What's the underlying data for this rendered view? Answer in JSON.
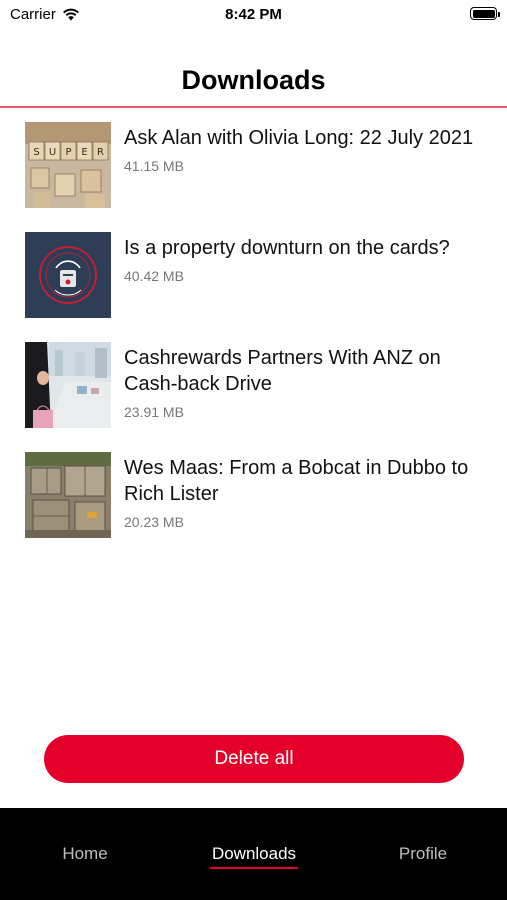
{
  "status_bar": {
    "carrier": "Carrier",
    "time": "8:42 PM"
  },
  "header": {
    "title": "Downloads"
  },
  "downloads": [
    {
      "title": "Ask Alan with Olivia Long: 22 July 2021",
      "size": "41.15 MB",
      "thumbnail": "super-wooden-blocks-image"
    },
    {
      "title": "Is a property downturn on the cards?",
      "size": "40.42 MB",
      "thumbnail": "the-money-cafe-logo"
    },
    {
      "title": "Cashrewards Partners With ANZ on Cash-back Drive",
      "size": "23.91 MB",
      "thumbnail": "shopping-mall-image"
    },
    {
      "title": "Wes Maas: From a Bobcat in Dubbo to Rich Lister",
      "size": "20.23 MB",
      "thumbnail": "construction-site-image"
    }
  ],
  "actions": {
    "delete_all": "Delete all"
  },
  "tabbar": {
    "home": "Home",
    "downloads": "Downloads",
    "profile": "Profile",
    "active": "Downloads"
  },
  "colors": {
    "accent": "#e4002b",
    "header_rule": "#e35c6b",
    "tabbar_bg": "#000000"
  }
}
